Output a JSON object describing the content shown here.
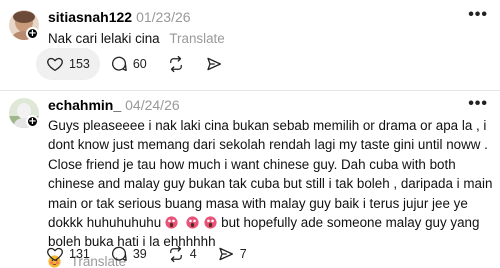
{
  "posts": [
    {
      "username": "sitiasnah122",
      "date": "01/23/26",
      "text": "Nak cari lelaki cina",
      "translate_label": "Translate",
      "likes": "153",
      "comments": "60",
      "reposts": "",
      "shares": "",
      "more_icon": "more-horizontal-icon"
    },
    {
      "username": "echahmin_",
      "date": "04/24/26",
      "text": "Guys pleaseeee i nak laki cina bukan sebab memilih or drama or apa la , i dont know just memang dari sekolah rendah lagi my taste gini until noww . Close friend je tau how much i want chinese guy. Dah cuba with both chinese and malay guy bukan tak cuba but still i tak boleh , daripada i main main or tak serious buang masa with malay guy baik i terus jujur jee ye dokkk huhuhuhuhu",
      "text_after_emoji": "but hopefully ade someone malay guy yang boleh buka hati i la ehhhhhh",
      "translate_label": "Translate",
      "likes": "131",
      "comments": "39",
      "reposts": "4",
      "shares": "7",
      "more_icon": "more-horizontal-icon"
    }
  ],
  "colors": {
    "text": "#111111",
    "muted": "#999999",
    "pill_bg": "#f0f0f0",
    "divider": "#e6e6e6",
    "emoji_face": "#e9537a"
  }
}
